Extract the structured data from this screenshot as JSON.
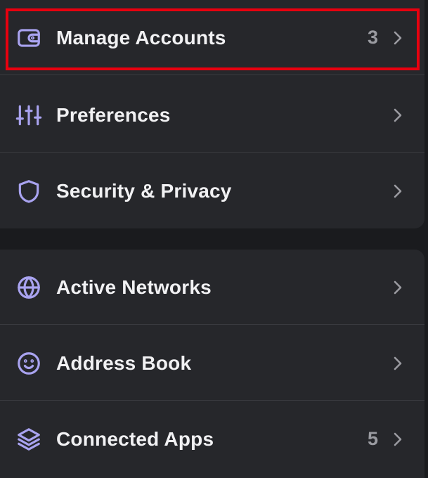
{
  "menu": {
    "group_one": [
      {
        "label": "Manage Accounts",
        "count": "3",
        "icon": "wallet-icon"
      },
      {
        "label": "Preferences",
        "count": "",
        "icon": "sliders-icon"
      },
      {
        "label": "Security & Privacy",
        "count": "",
        "icon": "shield-icon"
      }
    ],
    "group_two": [
      {
        "label": "Active Networks",
        "count": "",
        "icon": "globe-icon"
      },
      {
        "label": "Address Book",
        "count": "",
        "icon": "smiley-icon"
      },
      {
        "label": "Connected Apps",
        "count": "5",
        "icon": "layers-icon"
      }
    ]
  },
  "colors": {
    "background": "#1a1b1e",
    "card": "#26272b",
    "icon_accent": "#a9a3f0",
    "label": "#f1f1f3",
    "muted": "#9a9ba1",
    "highlight_border": "#e8000f"
  }
}
